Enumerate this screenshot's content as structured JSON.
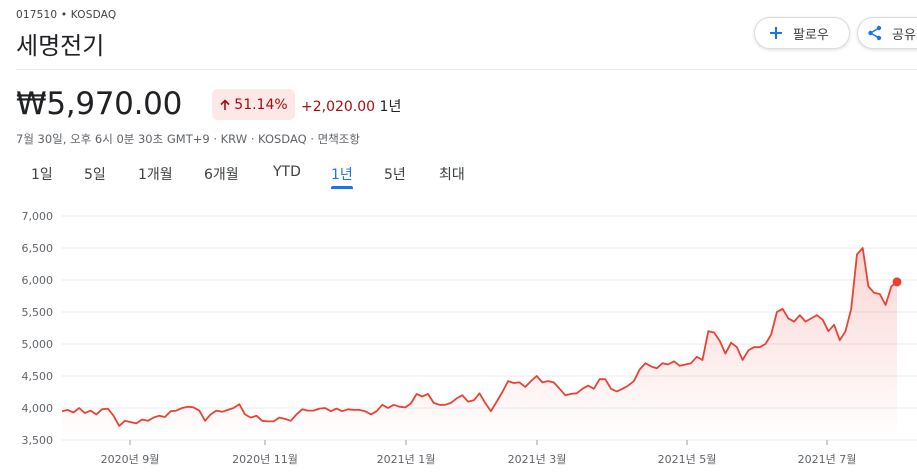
{
  "header": {
    "ticker": "017510 • KOSDAQ",
    "company": "세명전기",
    "follow_label": "팔로우",
    "share_label": "공유"
  },
  "quote": {
    "price": "₩5,970.00",
    "change_pct": "51.14%",
    "change_abs": "+2,020.00",
    "period": "1년",
    "meta": "7월 30일, 오후 6시 0분 30초 GMT+9 · KRW · KOSDAQ · 면책조항"
  },
  "tabs": [
    {
      "label": "1일",
      "active": false
    },
    {
      "label": "5일",
      "active": false
    },
    {
      "label": "1개월",
      "active": false
    },
    {
      "label": "6개월",
      "active": false
    },
    {
      "label": "YTD",
      "active": false
    },
    {
      "label": "1년",
      "active": true
    },
    {
      "label": "5년",
      "active": false
    },
    {
      "label": "최대",
      "active": false
    }
  ],
  "colors": {
    "line": "#e94235",
    "negative_text": "#a50e0e",
    "negative_bg": "#fce8e6",
    "accent": "#1a73e8"
  },
  "icons": {
    "follow": "plus-icon",
    "share": "share-icon",
    "change": "arrow-up-icon"
  },
  "chart_data": {
    "type": "area",
    "y_ticks": [
      "7,000",
      "6,500",
      "6,000",
      "5,500",
      "5,000",
      "4,500",
      "4,000",
      "3,500"
    ],
    "x_ticks": [
      "2020년 9월",
      "2020년 11월",
      "2021년 1월",
      "2021년 3월",
      "2021년 5월",
      "2021년 7월"
    ],
    "ylim": [
      3500,
      7000
    ],
    "grid": true,
    "series": [
      {
        "values": [
          3950,
          3970,
          3930,
          4000,
          3920,
          3960,
          3900,
          3980,
          3990,
          3880,
          3720,
          3800,
          3780,
          3760,
          3820,
          3800,
          3850,
          3880,
          3860,
          3950,
          3960,
          4000,
          4020,
          4010,
          3960,
          3800,
          3900,
          3960,
          3940,
          3970,
          4000,
          4060,
          3900,
          3850,
          3880,
          3800,
          3790,
          3790,
          3850,
          3830,
          3800,
          3900,
          3980,
          3960,
          3960,
          3990,
          4000,
          3950,
          3990,
          3950,
          3980,
          3970,
          3970,
          3950,
          3900,
          3950,
          4050,
          4000,
          4050,
          4020,
          4010,
          4070,
          4220,
          4180,
          4220,
          4080,
          4050,
          4050,
          4080,
          4150,
          4200,
          4100,
          4120,
          4230,
          4080,
          3950,
          4100,
          4250,
          4420,
          4390,
          4400,
          4330,
          4420,
          4500,
          4400,
          4420,
          4400,
          4300,
          4200,
          4220,
          4230,
          4300,
          4350,
          4300,
          4450,
          4450,
          4300,
          4260,
          4300,
          4350,
          4420,
          4600,
          4700,
          4650,
          4620,
          4700,
          4680,
          4730,
          4660,
          4680,
          4700,
          4800,
          4750,
          5200,
          5180,
          5050,
          4850,
          5020,
          4950,
          4750,
          4900,
          4950,
          4950,
          5000,
          5150,
          5500,
          5550,
          5400,
          5350,
          5450,
          5350,
          5400,
          5450,
          5380,
          5200,
          5300,
          5060,
          5200,
          5550,
          6400,
          6500,
          5900,
          5800,
          5780,
          5610,
          5900,
          5970
        ]
      }
    ]
  }
}
